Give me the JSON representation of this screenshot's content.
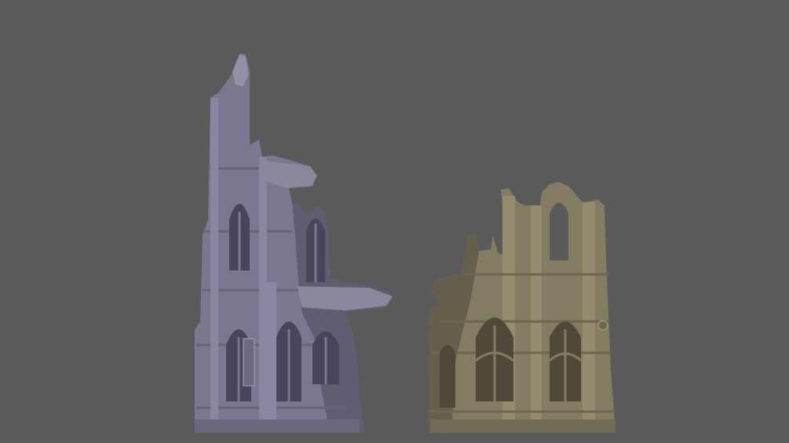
{
  "scene": {
    "background": "#5a5a5a",
    "objects": [
      {
        "id": "left",
        "kind": "ruined gothic tower",
        "color": "#7a7890",
        "shade": "#5f5d72",
        "highlight": "#9391a8"
      },
      {
        "id": "right",
        "kind": "ruined gothic wall section",
        "color": "#837b62",
        "shade": "#655f4b",
        "highlight": "#a0977a"
      }
    ]
  }
}
